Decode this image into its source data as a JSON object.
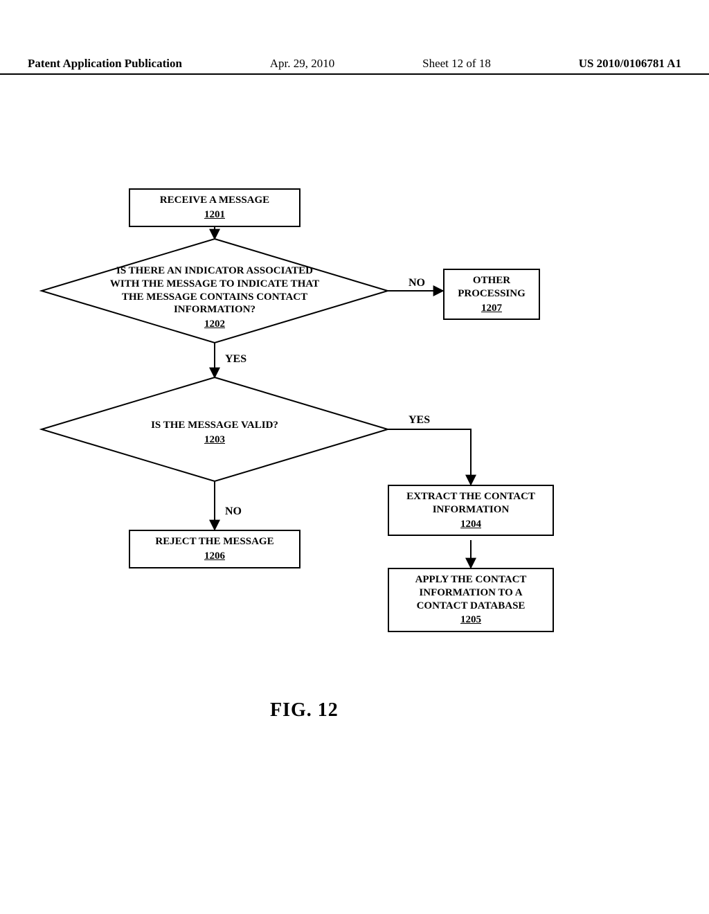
{
  "header": {
    "publication": "Patent Application Publication",
    "date": "Apr. 29, 2010",
    "sheet": "Sheet 12 of 18",
    "docnum": "US 2010/0106781 A1"
  },
  "nodes": {
    "n1201": {
      "text": "RECEIVE A MESSAGE",
      "ref": "1201"
    },
    "n1202": {
      "text": "IS THERE AN INDICATOR ASSOCIATED WITH THE MESSAGE TO INDICATE THAT THE MESSAGE CONTAINS CONTACT INFORMATION?",
      "ref": "1202"
    },
    "n1203": {
      "text": "IS THE MESSAGE VALID?",
      "ref": "1203"
    },
    "n1204": {
      "text": "EXTRACT THE CONTACT INFORMATION",
      "ref": "1204"
    },
    "n1205": {
      "text": "APPLY THE CONTACT INFORMATION TO A CONTACT DATABASE",
      "ref": "1205"
    },
    "n1206": {
      "text": "REJECT THE MESSAGE",
      "ref": "1206"
    },
    "n1207": {
      "text": "OTHER PROCESSING",
      "ref": "1207"
    }
  },
  "labels": {
    "no1": "NO",
    "yes1": "YES",
    "yes2": "YES",
    "no2": "NO"
  },
  "figure": "FIG.  12"
}
